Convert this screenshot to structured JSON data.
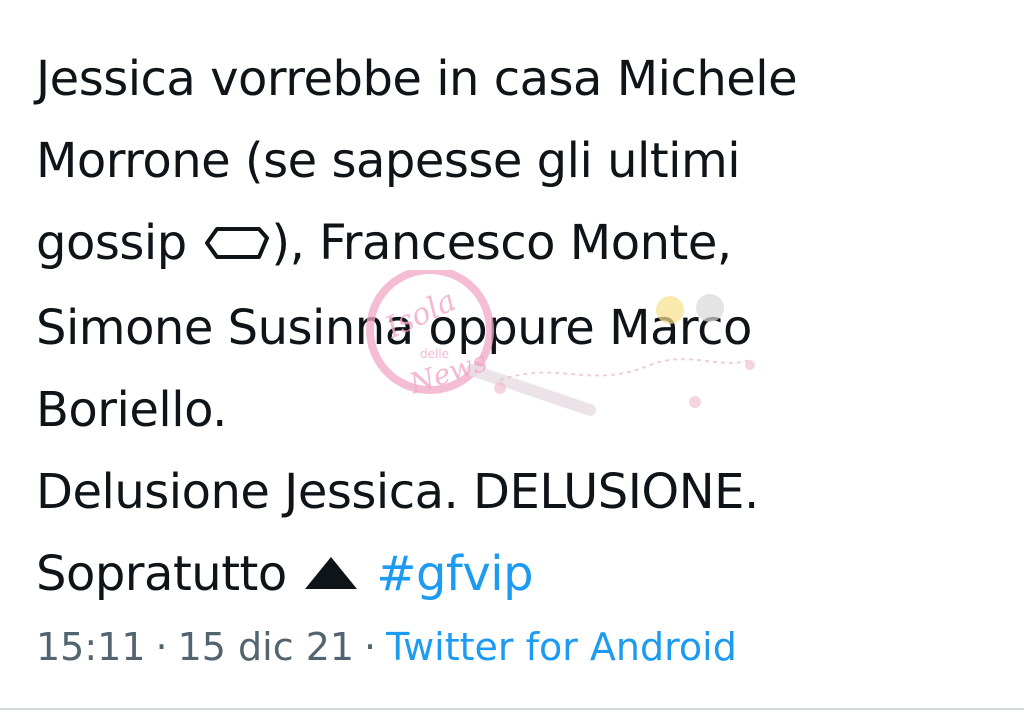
{
  "tweet": {
    "lines": [
      "Jessica vorrebbe in casa Michele",
      "Morrone (se sapesse gli ultimi",
      "gossip ",
      "), Francesco Monte,",
      "Simone Susinna oppure Marco",
      "Boriello.",
      "Delusione Jessica. DELUSIONE.",
      "Sopratutto ",
      "#gfvip"
    ],
    "icons": {
      "coffin": "coffin-icon",
      "triangle": "black-up-triangle-icon"
    },
    "hashtag_color": "#1d9bf0"
  },
  "meta": {
    "time": "15:11",
    "date": "15 dic 21",
    "separator": "·",
    "source": "Twitter for Android"
  },
  "watermark": {
    "text_main": "Isola",
    "text_sub": "delle",
    "text_news": "News"
  },
  "colors": {
    "text": "#0f1419",
    "meta": "#536471",
    "link": "#1d9bf0",
    "divider": "#cfd9de",
    "watermark_pink": "#f2a7c6"
  }
}
